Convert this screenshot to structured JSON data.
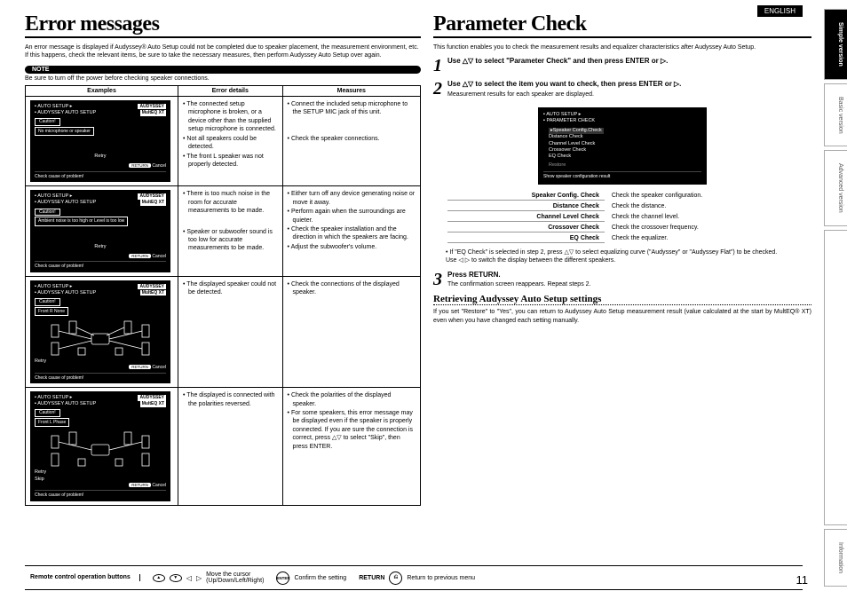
{
  "lang": "ENGLISH",
  "page_num": "11",
  "tabs": {
    "simple": "Simple version",
    "basic": "Basic version",
    "advanced": "Advanced version",
    "info": "Information"
  },
  "left": {
    "title": "Error messages",
    "intro": "An error message is displayed if Audyssey® Auto Setup could not be completed due to speaker placement, the measurement environment, etc. If this happens, check the relevant items, be sure to take the necessary measures, then perform Audyssey Auto Setup over again.",
    "note_label": "NOTE",
    "note_text": "Be sure to turn off the power before checking speaker connections.",
    "th": {
      "ex": "Examples",
      "det": "Error details",
      "mea": "Measures"
    },
    "rows": [
      {
        "screen": {
          "hdr": "AUTO SETUP ▸",
          "hdr2": "AUDYSSEY AUTO SETUP",
          "aud": "AUDYSSEY",
          "aud2": "MultEQ XT",
          "cau": "Caution!",
          "msg": "No microphone or speaker",
          "retry": "Retry",
          "foot": "Check cause of problem!"
        },
        "details": [
          "The connected setup microphone is broken, or a device other than the supplied setup microphone is connected.",
          "Not all speakers could be detected.",
          "The front L speaker was not properly detected."
        ],
        "measures": [
          "Connect the included setup microphone to the SETUP MIC jack of this unit.",
          "Check the speaker connections."
        ]
      },
      {
        "screen": {
          "hdr": "AUTO SETUP ▸",
          "hdr2": "AUDYSSEY AUTO SETUP",
          "aud": "AUDYSSEY",
          "aud2": "MultEQ XT",
          "cau": "Caution!",
          "msg": "Ambient noise is too high or Level is too low",
          "retry": "Retry",
          "foot": "Check cause of problem!"
        },
        "details": [
          "There is too much noise in the room for accurate measurements to be made.",
          "Speaker or subwoofer sound is too low for accurate measurements to be made."
        ],
        "measures": [
          "Either turn off any device generating noise or move it away.",
          "Perform again when the surroundings are quieter.",
          "Check the speaker installation and the direction in which the speakers are facing.",
          "Adjust the subwoofer's volume."
        ]
      },
      {
        "screen": {
          "hdr": "AUTO SETUP ▸",
          "hdr2": "AUDYSSEY AUTO SETUP",
          "aud": "AUDYSSEY",
          "aud2": "MultEQ XT",
          "cau": "Caution!",
          "msg": "Front R     None",
          "retry": "Retry",
          "foot": "Check cause of problem!"
        },
        "details": [
          "The displayed speaker could not be detected."
        ],
        "measures": [
          "Check the connections of the displayed speaker."
        ]
      },
      {
        "screen": {
          "hdr": "AUTO SETUP ▸",
          "hdr2": "AUDYSSEY AUTO SETUP",
          "aud": "AUDYSSEY",
          "aud2": "MultEQ XT",
          "cau": "Caution!",
          "msg": "Front L     Phase",
          "retry_skip": "Retry\nSkip",
          "foot": "Check cause of problem!"
        },
        "details": [
          "The displayed is connected with the polarities reversed."
        ],
        "measures": [
          "Check the polarities of the displayed speaker.",
          "For some speakers, this error message may be displayed even if the speaker is properly connected. If you are sure the connection is correct, press △▽ to select \"Skip\", then press ENTER."
        ]
      }
    ],
    "return_btn": "RETURN",
    "cancel": "Cancel"
  },
  "right": {
    "title": "Parameter Check",
    "intro": "This function enables you to check the measurement results and equalizer characteristics after Audyssey Auto Setup.",
    "step1": "Use △▽ to select \"Parameter Check\" and then press ENTER or ▷.",
    "step2": "Use △▽ to select the item you want to check, then press ENTER or ▷.",
    "step2_sub": "Measurement results for each speaker are displayed.",
    "check_screen": {
      "hdr": "AUTO SETUP ▸",
      "hdr2": "PARAMETER CHECK",
      "items": [
        "Speaker Config.Check",
        "Distance Check",
        "Channel Level Check",
        "Crossover Check",
        "EQ Check"
      ],
      "restore": "Restore",
      "foot": "Show speaker configuration result"
    },
    "checks": [
      {
        "k": "Speaker Config. Check",
        "v": "Check the speaker configuration."
      },
      {
        "k": "Distance Check",
        "v": "Check the distance."
      },
      {
        "k": "Channel Level Check",
        "v": "Check the channel level."
      },
      {
        "k": "Crossover Check",
        "v": "Check the crossover frequency."
      },
      {
        "k": "EQ Check",
        "v": "Check the equalizer."
      }
    ],
    "pc_note": "• If \"EQ Check\" is selected in step 2, press △▽ to select equalizing curve (\"Audyssey\" or \"Audyssey Flat\") to be checked.\nUse ◁ ▷ to switch the display between the different speakers.",
    "step3_a": "Press RETURN.",
    "step3_b": "The confirmation screen reappears. Repeat steps 2.",
    "retr_title": "Retrieving Audyssey Auto Setup settings",
    "retr_text": "If you set \"Restore\" to \"Yes\", you can return to Audyssey Auto Setup measurement result (value calculated at the start by MultEQ® XT) even when you have changed each setting manually."
  },
  "footer": {
    "label": "Remote control operation buttons",
    "move_desc": "Move the cursor\n(Up/Down/Left/Right)",
    "enter": "ENTER",
    "enter_desc": "Confirm the setting",
    "return": "RETURN",
    "return_desc": "Return to previous menu"
  }
}
